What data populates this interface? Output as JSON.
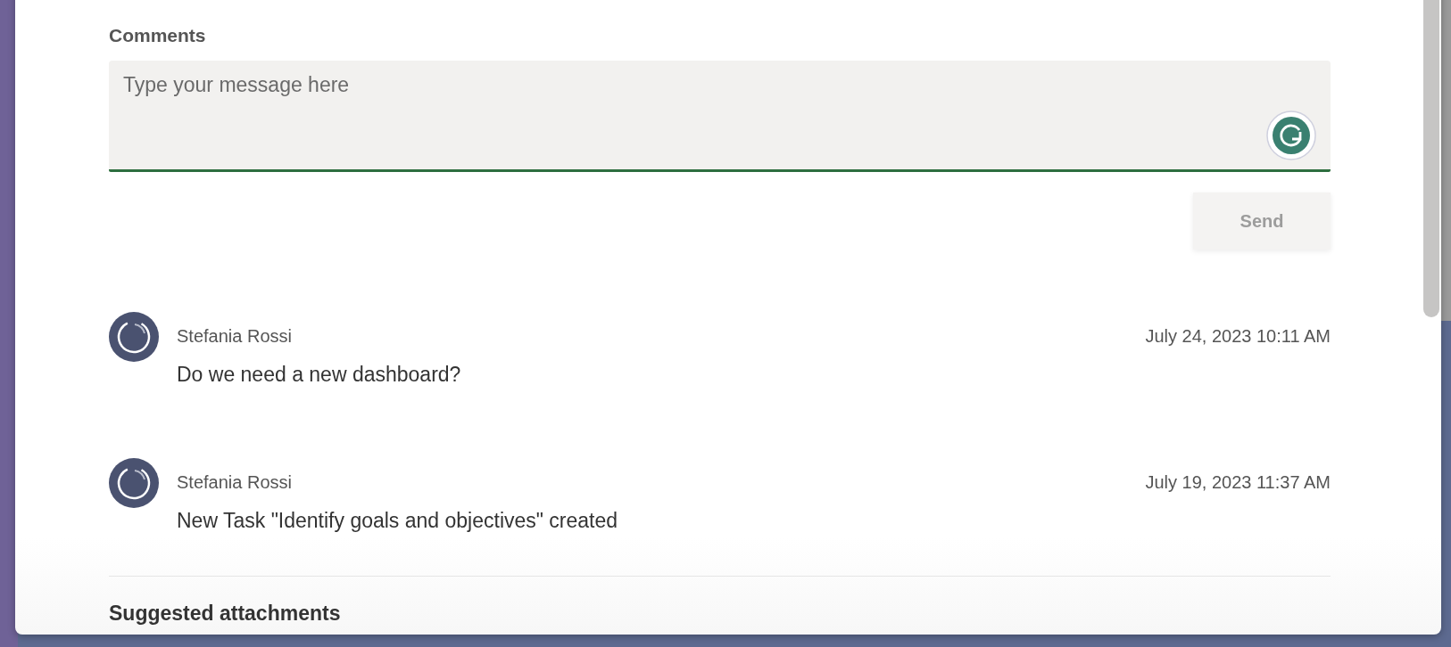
{
  "comments_label": "Comments",
  "message_field": {
    "placeholder": "Type your message here"
  },
  "send_button": {
    "label": "Send",
    "disabled": true
  },
  "comments": [
    {
      "author": "Stefania Rossi",
      "timestamp": "July 24, 2023 10:11 AM",
      "text": "Do we need a new dashboard?"
    },
    {
      "author": "Stefania Rossi",
      "timestamp": "July 19, 2023 11:37 AM",
      "text": "New Task \"Identify goals and objectives\" created"
    }
  ],
  "next_section": {
    "title": "Suggested attachments"
  }
}
